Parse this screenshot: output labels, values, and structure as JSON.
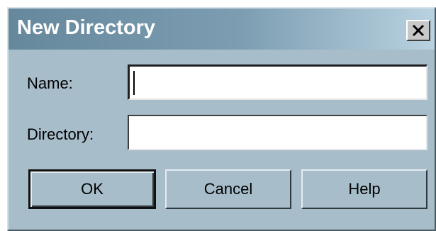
{
  "dialog": {
    "title": "New Directory",
    "close_icon": "close-x-icon"
  },
  "form": {
    "name_label": "Name:",
    "name_value": "",
    "directory_label": "Directory:",
    "directory_value": ""
  },
  "buttons": {
    "ok_label": "OK",
    "cancel_label": "Cancel",
    "help_label": "Help"
  },
  "colors": {
    "dialog_background": "#a7bdc9",
    "titlebar_start": "#66889c",
    "titlebar_end": "#b9d2e0",
    "title_text": "#ffffff"
  }
}
